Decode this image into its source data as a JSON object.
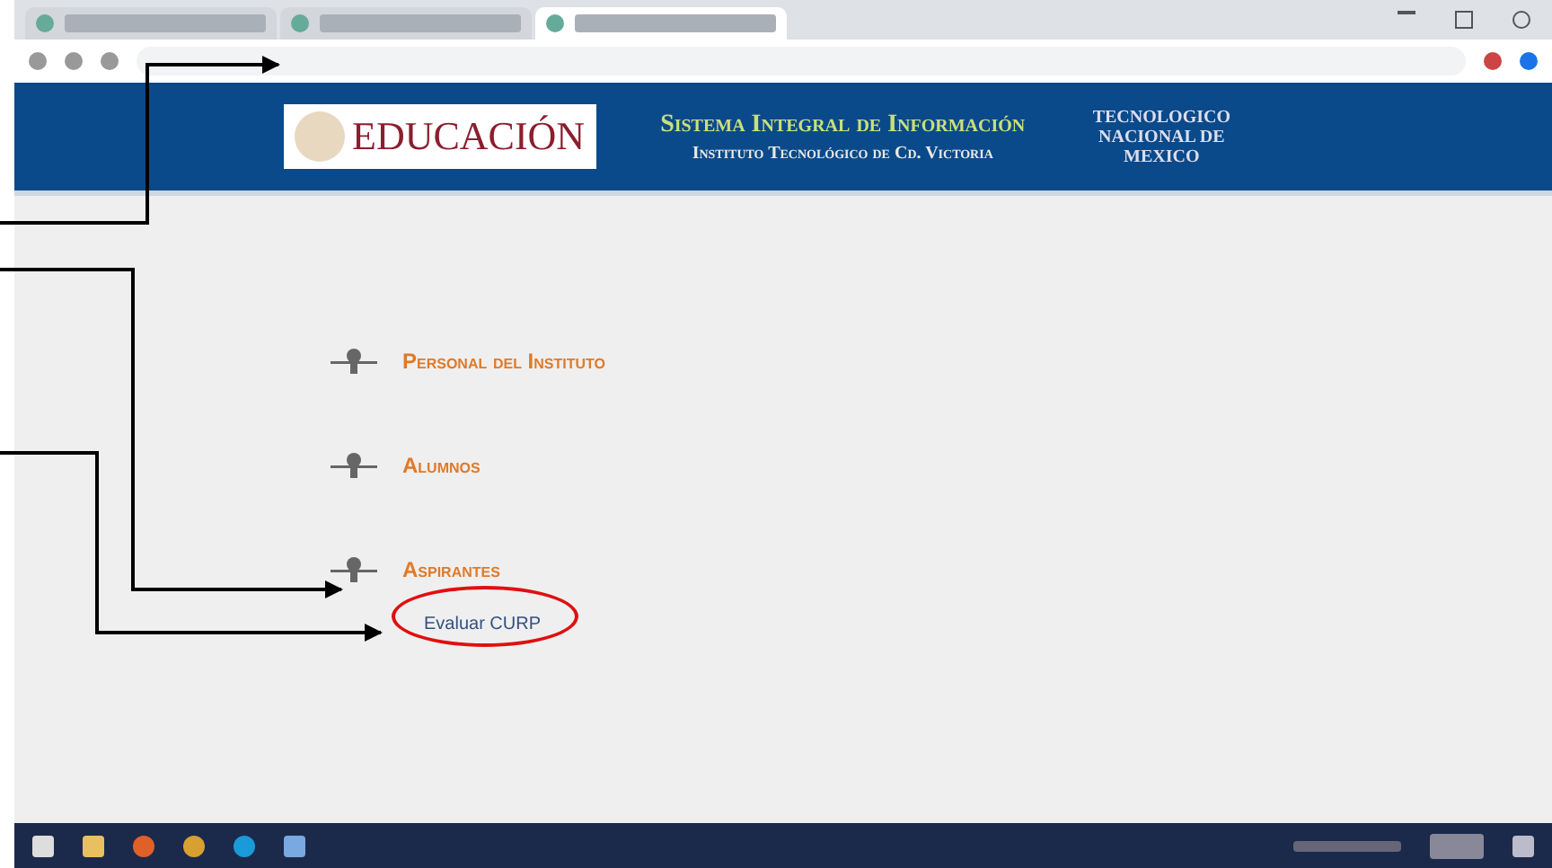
{
  "browser": {
    "tabs": [
      {
        "selected": false
      },
      {
        "selected": false
      },
      {
        "selected": true
      }
    ]
  },
  "header": {
    "logo_text": "EDUCACIÓN",
    "title": "Sistema Integral de Información",
    "subtitle": "Instituto Tecnológico de Cd. Victoria",
    "org": "TECNOLOGICO NACIONAL DE MEXICO"
  },
  "menu": [
    {
      "label": "Personal del Instituto"
    },
    {
      "label": "Alumnos"
    },
    {
      "label": "Aspirantes",
      "children": [
        {
          "label": "Evaluar CURP",
          "circled": true
        }
      ]
    }
  ]
}
